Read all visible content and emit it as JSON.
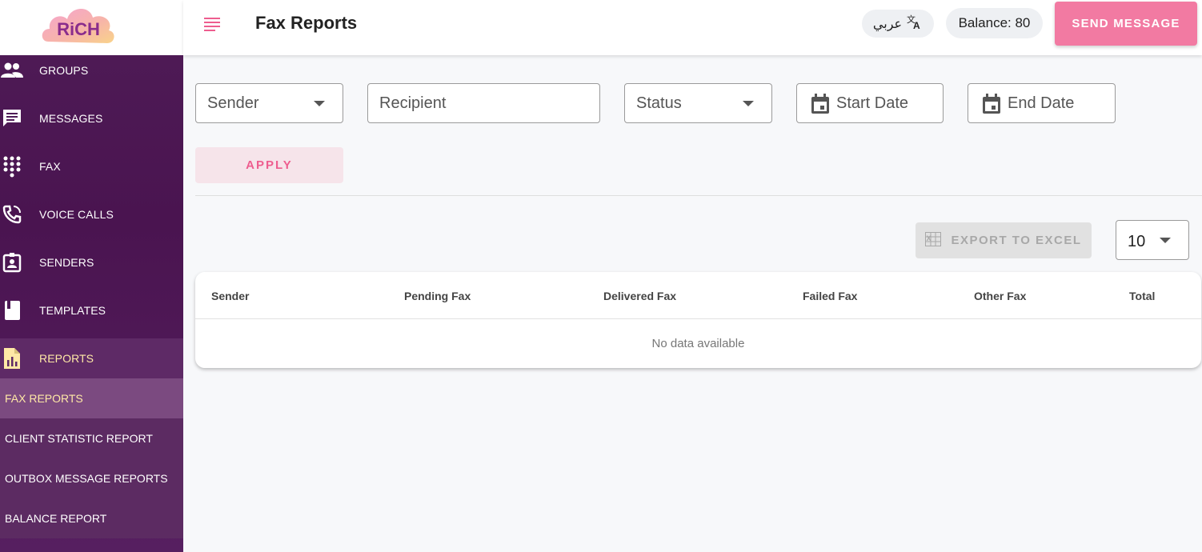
{
  "app": {
    "logo_text": "RiCH",
    "page_title": "Fax Reports"
  },
  "sidebar": {
    "items": [
      {
        "label": "GROUPS",
        "icon": "people-icon"
      },
      {
        "label": "MESSAGES",
        "icon": "message-icon"
      },
      {
        "label": "FAX",
        "icon": "dialpad-icon"
      },
      {
        "label": "VOICE CALLS",
        "icon": "phone-call-icon"
      },
      {
        "label": "SENDERS",
        "icon": "badge-icon"
      },
      {
        "label": "TEMPLATES",
        "icon": "book-icon"
      },
      {
        "label": "REPORTS",
        "icon": "report-icon",
        "active": true
      }
    ],
    "sub_items": [
      {
        "label": "FAX REPORTS",
        "active": true
      },
      {
        "label": "CLIENT STATISTIC REPORT"
      },
      {
        "label": "OUTBOX MESSAGE REPORTS"
      },
      {
        "label": "BALANCE REPORT"
      }
    ],
    "active_label_color": "#ffe9a6"
  },
  "header": {
    "language_label": "عربي",
    "balance_label": "Balance: 80",
    "send_message_label": "SEND MESSAGE"
  },
  "filters": {
    "sender": "Sender",
    "recipient": "Recipient",
    "status": "Status",
    "start_date": "Start Date",
    "end_date": "End Date",
    "apply_label": "APPLY"
  },
  "toolbar": {
    "export_label": "EXPORT TO EXCEL",
    "per_page": "10"
  },
  "table": {
    "columns": [
      "Sender",
      "Pending Fax",
      "Delivered Fax",
      "Failed Fax",
      "Other Fax",
      "Total"
    ],
    "empty_text": "No data available"
  },
  "colors": {
    "accent": "#f27aa2",
    "sidebar": "#4a1450"
  }
}
